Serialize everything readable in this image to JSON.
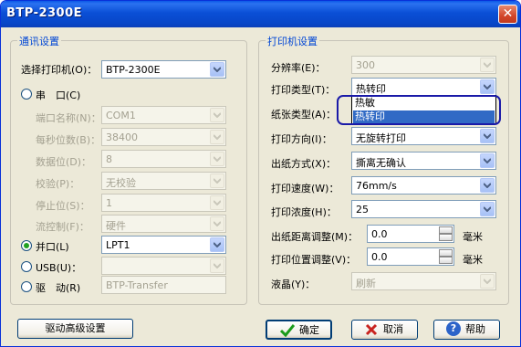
{
  "window": {
    "title": "BTP-2300E",
    "close_label": "✕"
  },
  "comm": {
    "title": "通讯设置",
    "printer_label": "选择打印机(O)：",
    "printer_value": "BTP-2300E",
    "serial_label": "串　口(C)",
    "port_name_label": "端口名称(N)：",
    "port_name_value": "COM1",
    "baud_label": "每秒位数(B)：",
    "baud_value": "38400",
    "databits_label": "数据位(D)：",
    "databits_value": "8",
    "parity_label": "校验(P)：",
    "parity_value": "无校验",
    "stopbits_label": "停止位(S)：",
    "stopbits_value": "1",
    "flow_label": "流控制(F)：",
    "flow_value": "硬件",
    "parallel_label": "并口(L)",
    "parallel_value": "LPT1",
    "usb_label": "USB(U)：",
    "usb_value": "",
    "driver_label": "驱　动(R)",
    "driver_value": "BTP-Transfer"
  },
  "printer": {
    "title": "打印机设置",
    "resolution_label": "分辨率(E)：",
    "resolution_value": "300",
    "print_type_label": "打印类型(T)：",
    "print_type_value": "热转印",
    "paper_type_label": "纸张类型(A)：",
    "dropdown_options": [
      "热敏",
      "热转印"
    ],
    "direction_label": "打印方向(I)：",
    "direction_value": "无旋转打印",
    "output_label": "出纸方式(X)：",
    "output_value": "撕离无确认",
    "speed_label": "打印速度(W)：",
    "speed_value": "76mm/s",
    "density_label": "打印浓度(H)：",
    "density_value": "25",
    "feed_adjust_label": "出纸距离调整(M)：",
    "feed_adjust_value": "0.0",
    "feed_unit": "毫米",
    "pos_adjust_label": "打印位置调整(V)：",
    "pos_adjust_value": "0.0",
    "pos_unit": "毫米",
    "lcd_label": "液晶(Y)：",
    "lcd_value": "刷新"
  },
  "buttons": {
    "advanced": "驱动高级设置",
    "ok": "确定",
    "cancel": "取消",
    "help": "帮助"
  }
}
